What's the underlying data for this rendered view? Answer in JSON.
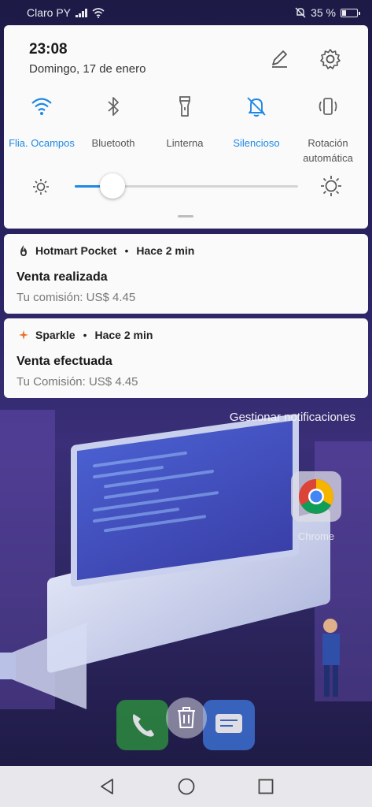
{
  "status_bar": {
    "carrier": "Claro PY",
    "battery_percent": "35 %",
    "battery_level": 0.35,
    "icons": [
      "signal-icon",
      "wifi-icon",
      "silent-icon",
      "battery-icon"
    ]
  },
  "quick_settings": {
    "time": "23:08",
    "date": "Domingo, 17 de enero",
    "edit_icon": "pencil-icon",
    "settings_icon": "gear-icon",
    "tiles": [
      {
        "label": "Flia. Ocampos",
        "icon": "wifi-icon",
        "active": true
      },
      {
        "label": "Bluetooth",
        "icon": "bluetooth-icon",
        "active": false
      },
      {
        "label": "Linterna",
        "icon": "flashlight-icon",
        "active": false
      },
      {
        "label": "Silencioso",
        "icon": "bell-off-icon",
        "active": true
      },
      {
        "label": "Rotación automática",
        "icon": "rotation-icon",
        "active": false
      }
    ],
    "brightness_level": 0.17,
    "accent_color": "#1e88e5"
  },
  "notifications": [
    {
      "app": "Hotmart Pocket",
      "time": "Hace 2 min",
      "title": "Venta realizada",
      "body": "Tu comisión: US$ 4.45",
      "icon": "hotmart-flame-icon"
    },
    {
      "app": "Sparkle",
      "time": "Hace 2 min",
      "title": "Venta efectuada",
      "body": "Tu Comisión: US$ 4.45",
      "icon": "sparkle-icon"
    }
  ],
  "manage_notifications": "Gestionar notificaciones",
  "home": {
    "chrome_label": "Chrome"
  },
  "nav": {
    "icons": [
      "back-icon",
      "home-icon",
      "recents-icon"
    ]
  }
}
